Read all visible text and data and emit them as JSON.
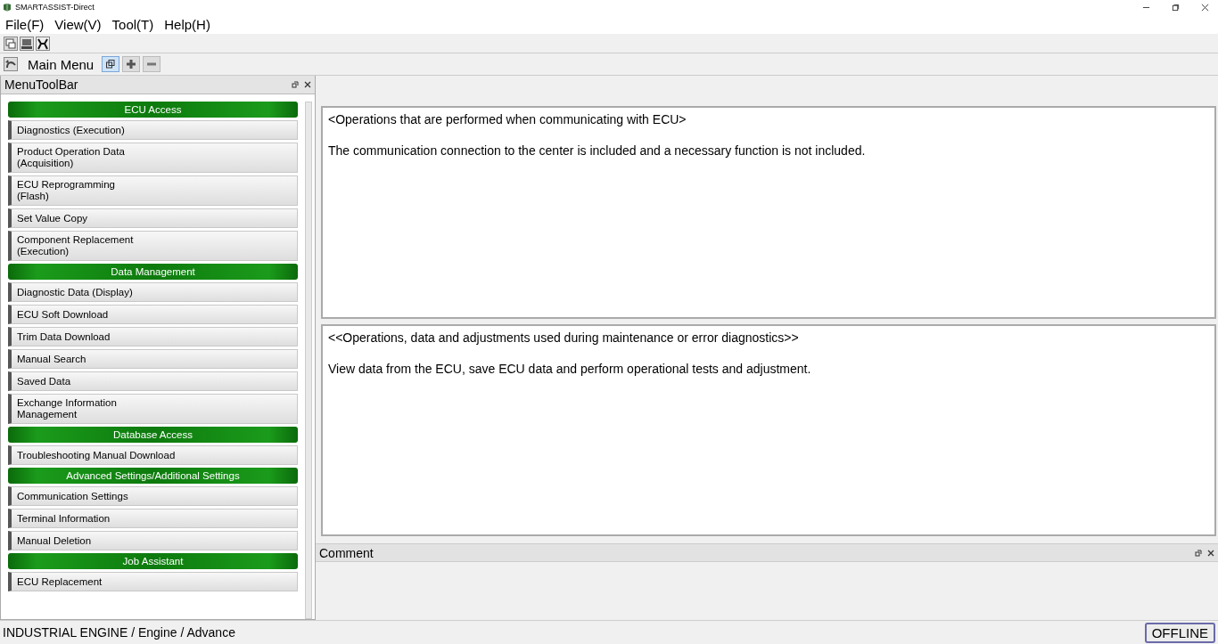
{
  "window": {
    "title": "SMARTASSIST-Direct"
  },
  "menu": [
    "File(F)",
    "View(V)",
    "Tool(T)",
    "Help(H)"
  ],
  "nav": {
    "title": "Main Menu",
    "view_buttons": [
      {
        "kind": "windows",
        "selected": true
      },
      {
        "kind": "plus",
        "selected": false
      },
      {
        "kind": "minus",
        "selected": false
      }
    ]
  },
  "sidebar": {
    "title": "MenuToolBar",
    "items": [
      {
        "kind": "header",
        "label": "ECU Access"
      },
      {
        "kind": "item",
        "label": "Diagnostics (Execution)"
      },
      {
        "kind": "item",
        "label": "Product Operation Data\n(Acquisition)"
      },
      {
        "kind": "item",
        "label": "ECU Reprogramming\n(Flash)"
      },
      {
        "kind": "item",
        "label": "Set Value Copy"
      },
      {
        "kind": "item",
        "label": "Component Replacement\n(Execution)"
      },
      {
        "kind": "header",
        "label": "Data Management"
      },
      {
        "kind": "item",
        "label": "Diagnostic Data (Display)"
      },
      {
        "kind": "item",
        "label": "ECU Soft Download"
      },
      {
        "kind": "item",
        "label": "Trim Data Download"
      },
      {
        "kind": "item",
        "label": "Manual Search"
      },
      {
        "kind": "item",
        "label": "Saved Data"
      },
      {
        "kind": "item",
        "label": "Exchange Information\nManagement"
      },
      {
        "kind": "header",
        "label": "Database Access"
      },
      {
        "kind": "item",
        "label": "Troubleshooting Manual Download"
      },
      {
        "kind": "header",
        "label": "Advanced Settings/Additional Settings"
      },
      {
        "kind": "item",
        "label": "Communication Settings"
      },
      {
        "kind": "item",
        "label": "Terminal Information"
      },
      {
        "kind": "item",
        "label": "Manual Deletion"
      },
      {
        "kind": "header",
        "label": "Job Assistant"
      },
      {
        "kind": "item",
        "label": "ECU Replacement"
      }
    ]
  },
  "panels": [
    {
      "heading": "<Operations that are performed when communicating with ECU>",
      "text": "The communication connection to the center is included and a necessary function is not included."
    },
    {
      "heading": "<<Operations, data and adjustments used during maintenance or error diagnostics>>",
      "text": "View data from the ECU, save ECU data and perform operational tests and adjustment."
    }
  ],
  "comment": {
    "title": "Comment"
  },
  "status_bar": {
    "path": "INDUSTRIAL ENGINE / Engine / Advance",
    "connection": "OFFLINE"
  }
}
